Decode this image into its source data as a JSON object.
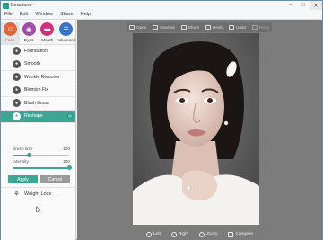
{
  "window": {
    "title": "Beautune",
    "controls": [
      "minimize-icon",
      "maximize-icon",
      "close-icon"
    ]
  },
  "menu": [
    "File",
    "Edit",
    "Window",
    "Share",
    "Help"
  ],
  "modes": [
    {
      "label": "Face",
      "icon": "face-icon",
      "color": "#e0663d",
      "active": true
    },
    {
      "label": "Eyes",
      "icon": "eye-icon",
      "color": "#a14baa",
      "active": false
    },
    {
      "label": "Mouth",
      "icon": "lips-icon",
      "color": "#d2307a",
      "active": false
    },
    {
      "label": "Advanced",
      "icon": "sliders-icon",
      "color": "#3b72c9",
      "active": false
    }
  ],
  "features": [
    {
      "label": "Foundation",
      "icon": "foundation-icon"
    },
    {
      "label": "Smooth",
      "icon": "smooth-icon"
    },
    {
      "label": "Wrinkle Remover",
      "icon": "wrinkle-icon"
    },
    {
      "label": "Blemish Fix",
      "icon": "blemish-icon"
    },
    {
      "label": "Blush Boost",
      "icon": "blush-icon"
    },
    {
      "label": "Reshape",
      "icon": "reshape-icon",
      "active": true
    }
  ],
  "reshape_panel": {
    "brush_size_label": "Brush size",
    "brush_size_value": "100",
    "brush_size_fraction": 0.3,
    "intensity_label": "Intensity",
    "intensity_value": "100",
    "intensity_fraction": 1.0,
    "apply_label": "Apply",
    "cancel_label": "Cancel"
  },
  "weight_loss": {
    "label": "Weight Loss",
    "icon": "body-icon"
  },
  "top_toolbar": [
    {
      "label": "Open",
      "icon": "open-icon"
    },
    {
      "label": "Save as",
      "icon": "save-icon"
    },
    {
      "label": "Share",
      "icon": "share-icon"
    },
    {
      "label": "Redo",
      "icon": "redo-icon"
    },
    {
      "label": "Undo",
      "icon": "undo-icon"
    },
    {
      "label": "Redo",
      "icon": "redo-icon",
      "disabled": true
    }
  ],
  "bottom_toolbar": [
    {
      "label": "Left",
      "icon": "rotate-left-icon"
    },
    {
      "label": "Right",
      "icon": "rotate-right-icon"
    },
    {
      "label": "Zoom",
      "icon": "zoom-icon"
    },
    {
      "label": "Compare",
      "icon": "compare-icon"
    }
  ],
  "colors": {
    "accent": "#3aa795",
    "canvas_bg": "#7c7c7c"
  }
}
